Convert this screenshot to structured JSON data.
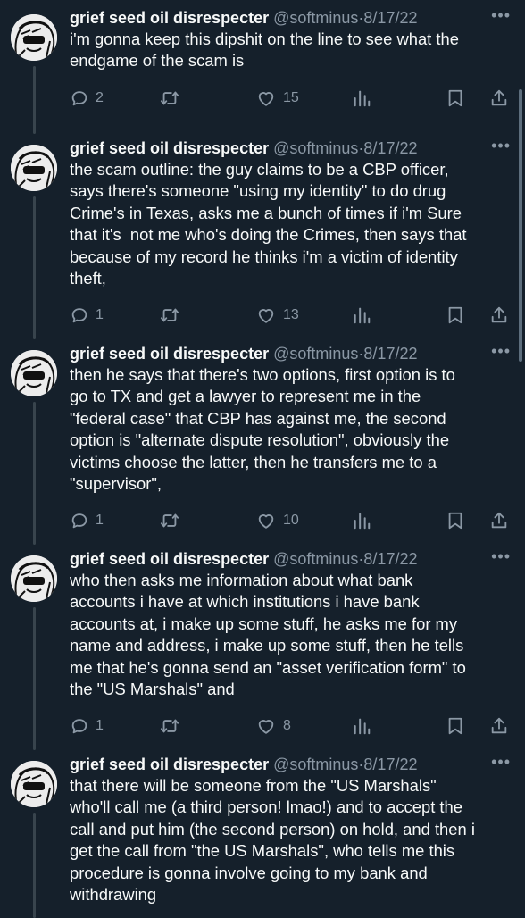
{
  "tweets": [
    {
      "name": "grief seed oil disrespecter",
      "handle": "@softminus",
      "separator": "·",
      "date": "8/17/22",
      "text": "i'm gonna keep this dipshit on the line to see what the\nendgame of the scam is",
      "replies": "2",
      "retweets": "",
      "likes": "15"
    },
    {
      "name": "grief seed oil disrespecter",
      "handle": "@softminus",
      "separator": "·",
      "date": "8/17/22",
      "text": "the scam outline: the guy claims to be a CBP officer,\nsays there's someone \"using my identity\" to do drug\nCrime's in Texas, asks me a bunch of times if i'm Sure\nthat it's  not me who's doing the Crimes, then says that\nbecause of my record he thinks i'm a victim of identity\ntheft,",
      "replies": "1",
      "retweets": "",
      "likes": "13"
    },
    {
      "name": "grief seed oil disrespecter",
      "handle": "@softminus",
      "separator": "·",
      "date": "8/17/22",
      "text": "then he says that there's two options, first option is to\ngo to TX and get a lawyer to represent me in the\n\"federal case\" that CBP has against me, the second\noption is \"alternate dispute resolution\", obviously the\nvictims choose the latter, then he transfers me to a\n\"supervisor\",",
      "replies": "1",
      "retweets": "",
      "likes": "10"
    },
    {
      "name": "grief seed oil disrespecter",
      "handle": "@softminus",
      "separator": "·",
      "date": "8/17/22",
      "text": "who then asks me information about what bank\naccounts i have at which institutions i have bank\naccounts at, i make up some stuff, he asks me for my\nname and address, i make up some stuff, then he tells\nme that he's gonna send an \"asset verification form\" to\nthe \"US Marshals\" and",
      "replies": "1",
      "retweets": "",
      "likes": "8"
    },
    {
      "name": "grief seed oil disrespecter",
      "handle": "@softminus",
      "separator": "·",
      "date": "8/17/22",
      "text": "that there will be someone from the \"US Marshals\"\nwho'll call me (a third person! lmao!) and to accept the\ncall and put him (the second person) on hold, and then i\nget the call from \"the US Marshals\", who tells me this\nprocedure is gonna involve going to my bank and\nwithdrawing",
      "replies": "",
      "retweets": "",
      "likes": ""
    }
  ],
  "icons": {
    "reply": "reply-icon",
    "retweet": "retweet-icon",
    "like": "heart-icon",
    "stats": "views-icon",
    "bookmark": "bookmark-icon",
    "share": "share-icon",
    "more": "more-icon"
  },
  "colors": {
    "background": "#15202b",
    "text": "#f7f9f9",
    "secondary": "#8b98a5",
    "thread_line": "#38444d"
  }
}
